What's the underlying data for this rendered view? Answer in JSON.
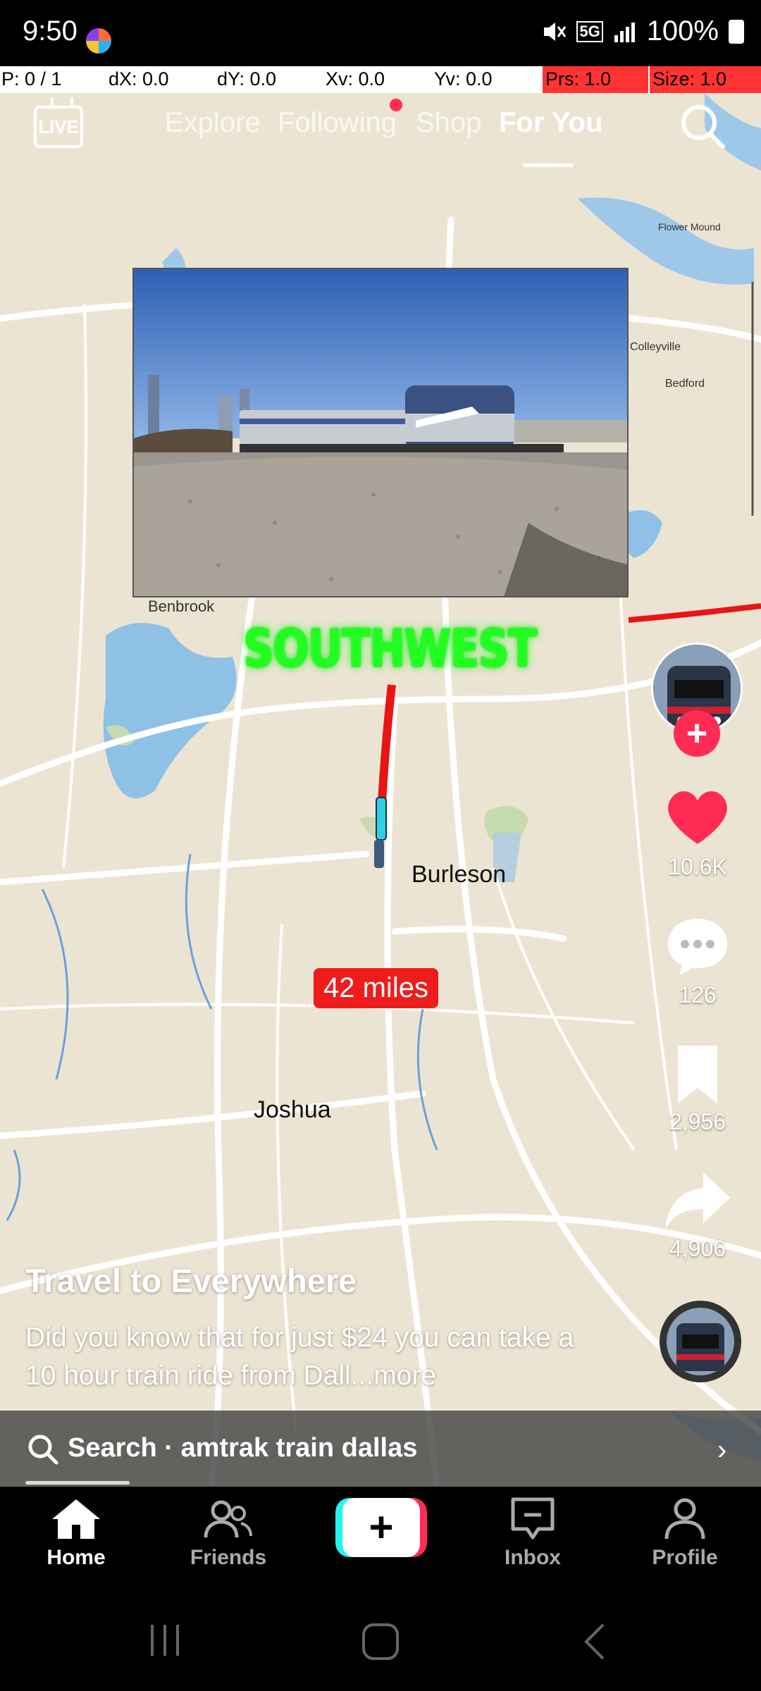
{
  "status_bar": {
    "time": "9:50",
    "network": "5G",
    "battery": "100%"
  },
  "debug_overlay": {
    "p": "P: 0 / 1",
    "dx": "dX: 0.0",
    "dy": "dY: 0.0",
    "xv": "Xv: 0.0",
    "yv": "Yv: 0.0",
    "prs": "Prs: 1.0",
    "size": "Size: 1.0"
  },
  "top_nav": {
    "live": "LIVE",
    "tabs": [
      {
        "label": "Explore",
        "active": false
      },
      {
        "label": "Following",
        "active": false
      },
      {
        "label": "Shop",
        "active": false
      },
      {
        "label": "For You",
        "active": true
      }
    ]
  },
  "video": {
    "overlay_text": "SOUTHWEST",
    "distance_label": "42 miles",
    "places": [
      "Benbrook",
      "Burleson",
      "Joshua",
      "Colleyville",
      "Bedford",
      "Flower Mound"
    ]
  },
  "rail": {
    "likes": "10.6K",
    "comments": "126",
    "saves": "2,956",
    "shares": "4,906"
  },
  "caption": {
    "title": "Travel to Everywhere",
    "description": "Did you know that for just $24 you can take a 10 hour train ride from Dall...",
    "more": "more"
  },
  "search_bar": {
    "text": "Search · amtrak train dallas"
  },
  "bottom_nav": {
    "home": "Home",
    "friends": "Friends",
    "inbox": "Inbox",
    "profile": "Profile"
  },
  "colors": {
    "accent_red": "#fe2c55",
    "accent_cyan": "#25f4ee",
    "overlay_green": "#1fff1f",
    "route_red": "#ee1c1c"
  }
}
